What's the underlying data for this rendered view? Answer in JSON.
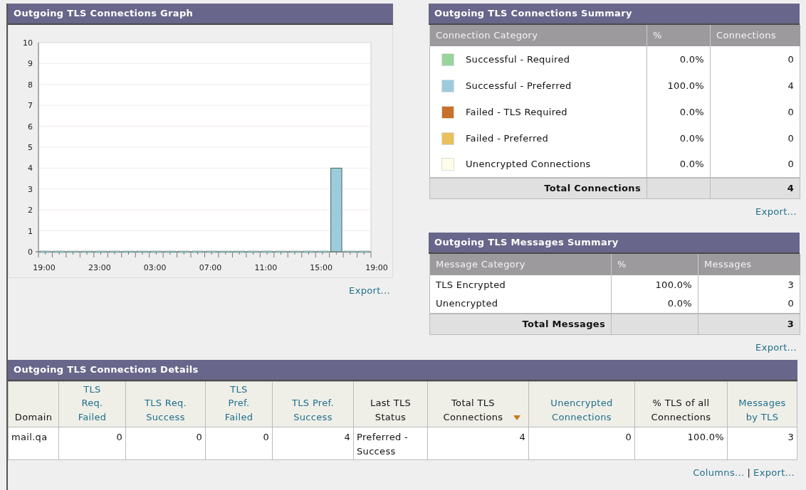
{
  "graph_panel": {
    "title": "Outgoing TLS Connections Graph",
    "export": "Export...",
    "chart_data": {
      "type": "bar",
      "grid": true,
      "categories": [
        "19:00",
        null,
        null,
        null,
        "23:00",
        null,
        null,
        null,
        "03:00",
        null,
        null,
        null,
        "07:00",
        null,
        null,
        null,
        "11:00",
        null,
        null,
        null,
        "15:00",
        null,
        null,
        null,
        "19:00"
      ],
      "series": [
        {
          "color": "#9ccbde",
          "values": [
            0,
            0,
            0,
            0,
            0,
            0,
            0,
            0,
            0,
            0,
            0,
            0,
            0,
            0,
            0,
            0,
            0,
            0,
            0,
            0,
            0,
            4,
            0,
            0,
            null
          ]
        }
      ],
      "ylim": [
        0,
        10
      ],
      "yticks": [
        0,
        1,
        2,
        3,
        4,
        5,
        6,
        7,
        8,
        9,
        10
      ]
    }
  },
  "connections_summary": {
    "title": "Outgoing TLS Connections Summary",
    "columns": [
      "Connection Category",
      "%",
      "Connections"
    ],
    "rows": [
      {
        "category": "Successful - Required",
        "color": "#98d49c",
        "percent": "0.0%",
        "count": "0"
      },
      {
        "category": "Successful - Preferred",
        "color": "#9ccbde",
        "percent": "100.0%",
        "count": "4"
      },
      {
        "category": "Failed - TLS Required",
        "color": "#c8712b",
        "percent": "0.0%",
        "count": "0"
      },
      {
        "category": "Failed - Preferred",
        "color": "#e8c05c",
        "percent": "0.0%",
        "count": "0"
      },
      {
        "category": "Unencrypted Connections",
        "color": "#fdfdea",
        "percent": "0.0%",
        "count": "0"
      }
    ],
    "total": {
      "label": "Total Connections",
      "count": "4"
    },
    "export": "Export..."
  },
  "messages_summary": {
    "title": "Outgoing TLS Messages Summary",
    "columns": [
      "Message Category",
      "%",
      "Messages"
    ],
    "rows": [
      {
        "category": "TLS Encrypted",
        "percent": "100.0%",
        "count": "3"
      },
      {
        "category": "Unencrypted",
        "percent": "0.0%",
        "count": "0"
      }
    ],
    "total": {
      "label": "Total Messages",
      "count": "3"
    },
    "export": "Export..."
  },
  "details": {
    "title": "Outgoing TLS Connections Details",
    "columns": [
      {
        "label": "Domain",
        "link": false,
        "sorted": false
      },
      {
        "label": "TLS Req. Failed",
        "link": true,
        "sorted": false
      },
      {
        "label": "TLS Req. Success",
        "link": true,
        "sorted": false
      },
      {
        "label": "TLS Pref. Failed",
        "link": true,
        "sorted": false
      },
      {
        "label": "TLS Pref. Success",
        "link": true,
        "sorted": false
      },
      {
        "label": "Last TLS Status",
        "link": false,
        "sorted": false
      },
      {
        "label": "Total TLS Connections",
        "link": false,
        "sorted": true
      },
      {
        "label": "Unencrypted Connections",
        "link": true,
        "sorted": false
      },
      {
        "label": "% TLS of all Connections",
        "link": false,
        "sorted": false
      },
      {
        "label": "Messages by TLS",
        "link": true,
        "sorted": false
      }
    ],
    "rows": [
      [
        "mail.qa",
        "0",
        "0",
        "0",
        "4",
        "Preferred - Success",
        "4",
        "0",
        "100.0%",
        "3"
      ]
    ],
    "columns_link": "Columns...",
    "separator": "|",
    "export": "Export..."
  }
}
